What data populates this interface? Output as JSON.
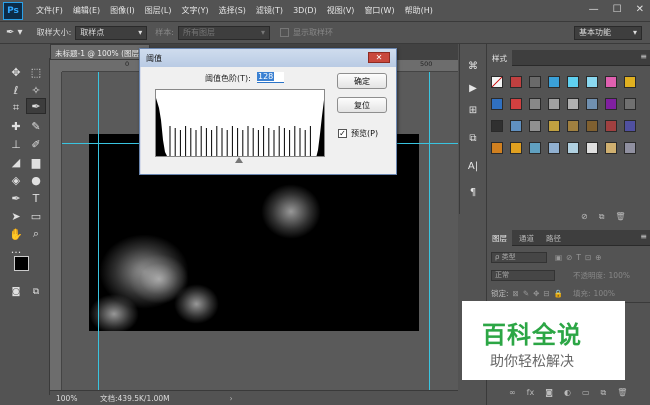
{
  "menubar": {
    "logo": "Ps",
    "items": [
      "文件(F)",
      "编辑(E)",
      "图像(I)",
      "图层(L)",
      "文字(Y)",
      "选择(S)",
      "滤镜(T)",
      "3D(D)",
      "视图(V)",
      "窗口(W)",
      "帮助(H)"
    ],
    "window_controls": [
      "—",
      "☐",
      "✕"
    ]
  },
  "options_bar": {
    "sample_size_label": "取样大小:",
    "sample_size_value": "取样点",
    "sample_label": "样本:",
    "sample_value": "所有图层",
    "show_ring_label": "显示取样环",
    "workspace": "基本功能"
  },
  "document": {
    "tab_title": "未标题-1 @ 100% (图层",
    "ruler_ticks": [
      "0",
      "50",
      "500"
    ],
    "zoom": "100%",
    "doc_info": "文档:439.5K/1.00M"
  },
  "threshold_dialog": {
    "title": "阈值",
    "close": "✕",
    "level_label": "阈值色阶(T):",
    "level_value": "128",
    "ok_label": "确定",
    "reset_label": "复位",
    "preview_label": "预览(P)",
    "preview_checked": true,
    "check_mark": "✓"
  },
  "panels": {
    "styles": {
      "tab": "样式",
      "swatch_colors": [
        [
          "#f4f4f4",
          "#c04040",
          "#6a6a6a",
          "#3aa0d8",
          "#5fd0f0",
          "#8ad8f0",
          "#e060b0",
          "#e0b020"
        ],
        [
          "#3070c0",
          "#d04040",
          "#888888",
          "#a0a0a0",
          "#b0b0b0",
          "#7090b0",
          "#8020a0",
          "#707070"
        ],
        [
          "#303030",
          "#6090c0",
          "#909090",
          "#c0a040",
          "#a08040",
          "#806030",
          "#a04040",
          "#5050a0"
        ],
        [
          "#d08020",
          "#e0a020",
          "#60a0c0",
          "#90b0d0",
          "#b0d0e0",
          "#e0e0e0",
          "#d0b070",
          "#9090a0"
        ]
      ]
    },
    "layers": {
      "tabs": [
        "图层",
        "通道",
        "路径"
      ],
      "kind_label": "ρ 类型",
      "blend_mode": "正常",
      "opacity_label": "不透明度:",
      "opacity_value": "100%",
      "lock_label": "锁定:",
      "fill_label": "填充:",
      "fill_value": "100%"
    }
  },
  "watermark": {
    "title": "百科全说",
    "subtitle": "助你轻松解决"
  }
}
